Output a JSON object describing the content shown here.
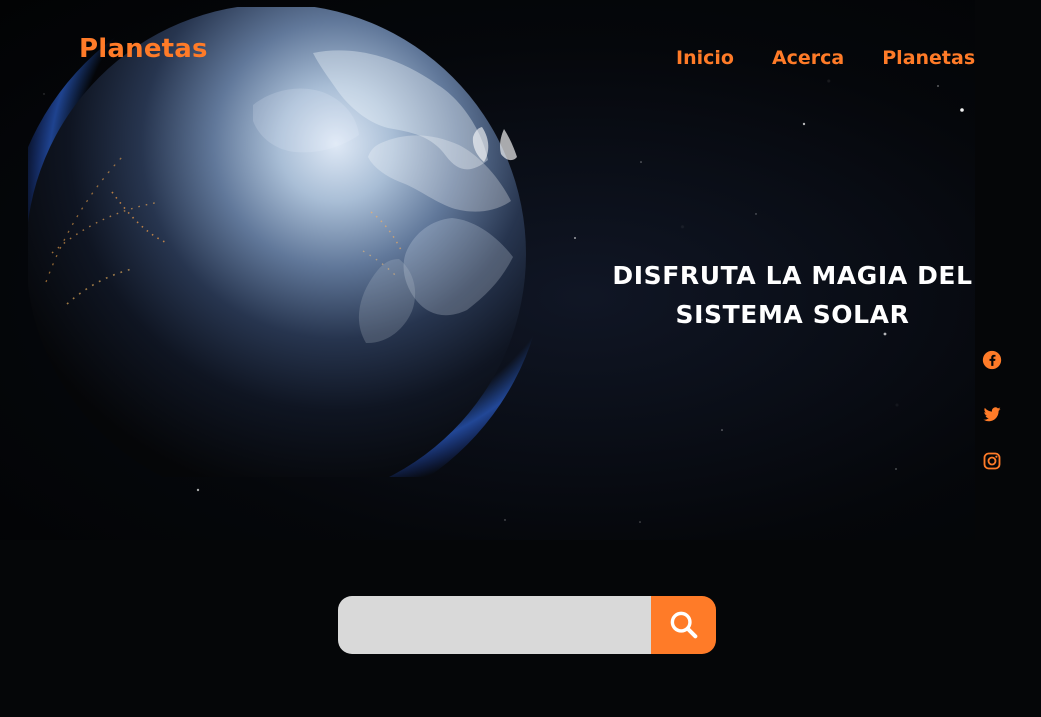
{
  "brand": {
    "logo_text": "Planetas",
    "accent_color": "#ff7b28"
  },
  "nav": {
    "items": [
      {
        "label": "Inicio"
      },
      {
        "label": "Acerca"
      },
      {
        "label": "Planetas"
      }
    ]
  },
  "hero": {
    "title_line_1": "DISFRUTA LA MAGIA DEL",
    "title_line_2": "SISTEMA SOLAR",
    "background_image": "earth-from-space"
  },
  "social": {
    "icons": [
      {
        "name": "facebook-icon"
      },
      {
        "name": "twitter-icon"
      },
      {
        "name": "instagram-icon"
      }
    ]
  },
  "search": {
    "value": "",
    "placeholder": "",
    "icon": "search-icon",
    "button_color": "#ff7b28"
  }
}
